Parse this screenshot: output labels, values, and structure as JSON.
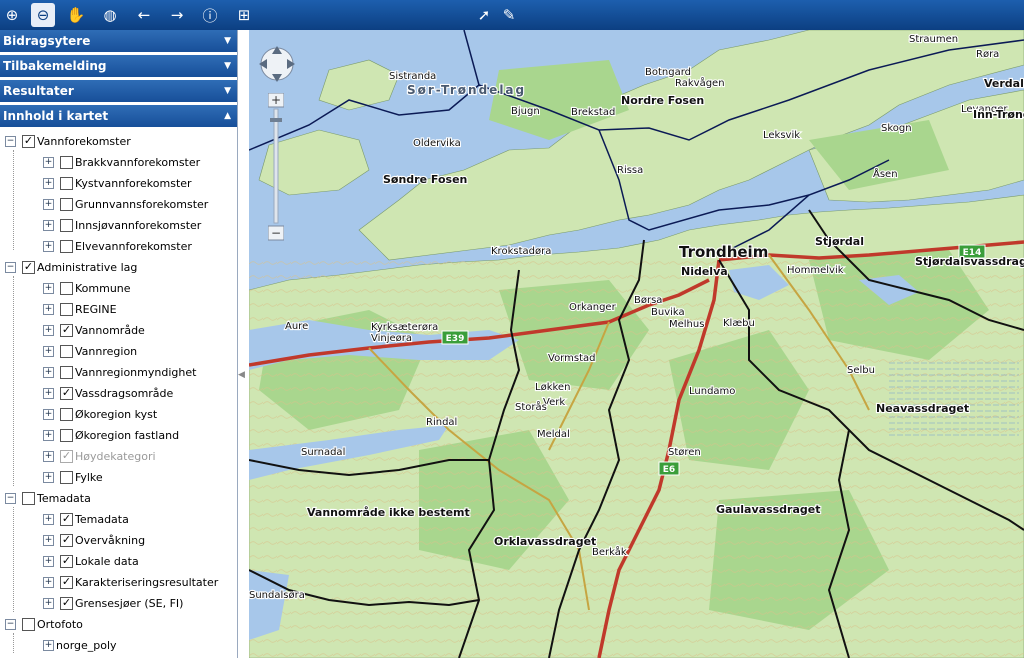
{
  "toolbar": {
    "tools": [
      {
        "name": "zoom-in-icon",
        "glyph": "⊕"
      },
      {
        "name": "zoom-out-icon",
        "glyph": "⊖"
      },
      {
        "name": "pan-hand-icon",
        "glyph": "✋"
      },
      {
        "name": "full-extent-icon",
        "glyph": "◍"
      },
      {
        "name": "back-arrow-icon",
        "glyph": "←"
      },
      {
        "name": "forward-arrow-icon",
        "glyph": "→"
      },
      {
        "name": "info-icon",
        "glyph": "ⓘ"
      },
      {
        "name": "measure-icon",
        "glyph": "⊞"
      },
      {
        "name": "select-tool-icon",
        "glyph": "➚"
      },
      {
        "name": "draw-pen-icon",
        "glyph": "✎"
      }
    ]
  },
  "sidebar": {
    "panels": [
      "Bidragsytere",
      "Tilbakemelding",
      "Resultater",
      "Innhold i kartet"
    ],
    "tree": [
      {
        "label": "Vannforekomster",
        "level": 0,
        "checked": true
      },
      {
        "label": "Brakkvannforekomster",
        "level": 1,
        "checked": false
      },
      {
        "label": "Kystvannforekomster",
        "level": 1,
        "checked": false
      },
      {
        "label": "Grunnvannsforekomster",
        "level": 1,
        "checked": false
      },
      {
        "label": "Innsjøvannforekomster",
        "level": 1,
        "checked": false
      },
      {
        "label": "Elvevannforekomster",
        "level": 1,
        "checked": false
      },
      {
        "label": "Administrative lag",
        "level": 0,
        "checked": true
      },
      {
        "label": "Kommune",
        "level": 1,
        "checked": false
      },
      {
        "label": "REGINE",
        "level": 1,
        "checked": false
      },
      {
        "label": "Vannområde",
        "level": 1,
        "checked": true
      },
      {
        "label": "Vannregion",
        "level": 1,
        "checked": false
      },
      {
        "label": "Vannregionmyndighet",
        "level": 1,
        "checked": false
      },
      {
        "label": "Vassdragsområde",
        "level": 1,
        "checked": true
      },
      {
        "label": "Økoregion kyst",
        "level": 1,
        "checked": false
      },
      {
        "label": "Økoregion fastland",
        "level": 1,
        "checked": false
      },
      {
        "label": "Høydekategori",
        "level": 1,
        "checked": true,
        "disabled": true
      },
      {
        "label": "Fylke",
        "level": 1,
        "checked": false
      },
      {
        "label": "Temadata",
        "level": 0,
        "checked": false
      },
      {
        "label": "Temadata",
        "level": 1,
        "checked": true
      },
      {
        "label": "Overvåkning",
        "level": 1,
        "checked": true
      },
      {
        "label": "Lokale data",
        "level": 1,
        "checked": true
      },
      {
        "label": "Karakteriseringsresultater",
        "level": 1,
        "checked": true
      },
      {
        "label": "Grensesjøer (SE, FI)",
        "level": 1,
        "checked": true
      },
      {
        "label": "Ortofoto",
        "level": 0,
        "checked": false
      },
      {
        "label": "norge_poly",
        "level": 1,
        "noCheckbox": true
      }
    ]
  },
  "map": {
    "colors": {
      "water": "#a7c7ea",
      "land": "#cfe6b2",
      "forest": "#a9d68e",
      "road": "#c0392b",
      "border": "#0b1a55"
    },
    "labels": [
      {
        "text": "Straumen",
        "bold": false
      },
      {
        "text": "Røra",
        "bold": false
      },
      {
        "text": "Verdal",
        "bold": true
      },
      {
        "text": "Sistranda",
        "bold": false
      },
      {
        "text": "Sør-Trøndelag",
        "bold": false
      },
      {
        "text": "Botngard",
        "bold": false
      },
      {
        "text": "Rakvågen",
        "bold": false
      },
      {
        "text": "Nordre Fosen",
        "bold": true
      },
      {
        "text": "Bjugn",
        "bold": false
      },
      {
        "text": "Brekstad",
        "bold": false
      },
      {
        "text": "Levanger",
        "bold": false
      },
      {
        "text": "Inn-Trøndelag",
        "bold": true
      },
      {
        "text": "Skogn",
        "bold": false
      },
      {
        "text": "Leksvik",
        "bold": false
      },
      {
        "text": "Oldervika",
        "bold": false
      },
      {
        "text": "Rissa",
        "bold": false
      },
      {
        "text": "Åsen",
        "bold": false
      },
      {
        "text": "Søndre Fosen",
        "bold": true
      },
      {
        "text": "Trondheim",
        "bold": true
      },
      {
        "text": "Stjørdal",
        "bold": true
      },
      {
        "text": "Nidelva",
        "bold": true
      },
      {
        "text": "Hommelvik",
        "bold": false
      },
      {
        "text": "Stjørdalsvassdrag",
        "bold": true
      },
      {
        "text": "Krokstadøra",
        "bold": false
      },
      {
        "text": "Aure",
        "bold": false
      },
      {
        "text": "Kyrksæterøra",
        "bold": false
      },
      {
        "text": "Orkanger",
        "bold": false
      },
      {
        "text": "Børsa",
        "bold": false
      },
      {
        "text": "Buvika",
        "bold": false
      },
      {
        "text": "Melhus",
        "bold": false
      },
      {
        "text": "Klæbu",
        "bold": false
      },
      {
        "text": "Vinjeøra",
        "bold": false
      },
      {
        "text": "Vormstad",
        "bold": false
      },
      {
        "text": "Løkken",
        "bold": false
      },
      {
        "text": "Verk",
        "bold": false
      },
      {
        "text": "Storås",
        "bold": false
      },
      {
        "text": "Lundamo",
        "bold": false
      },
      {
        "text": "Selbu",
        "bold": false
      },
      {
        "text": "Neavassdraget",
        "bold": true
      },
      {
        "text": "Rindal",
        "bold": false
      },
      {
        "text": "Meldal",
        "bold": false
      },
      {
        "text": "Støren",
        "bold": false
      },
      {
        "text": "Surnadal",
        "bold": false
      },
      {
        "text": "Vannområde ikke bestemt",
        "bold": true
      },
      {
        "text": "Gaulavassdraget",
        "bold": true
      },
      {
        "text": "Orklavassdraget",
        "bold": true
      },
      {
        "text": "Berkåk",
        "bold": false
      },
      {
        "text": "Sundalsøra",
        "bold": false
      }
    ],
    "road_shields": [
      "E39",
      "E6",
      "E14"
    ]
  }
}
